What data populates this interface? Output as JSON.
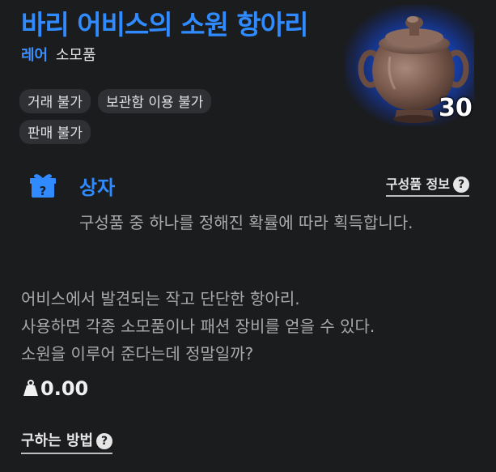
{
  "item": {
    "name": "바리 어비스의 소원 항아리",
    "rarity": "레어",
    "category": "소모품",
    "count": "30",
    "tags": [
      "거래 불가",
      "보관함 이용 불가",
      "판매 불가"
    ],
    "icon": "clay-pot-icon"
  },
  "box": {
    "label": "상자",
    "icon": "gift-box-icon",
    "composition_link": "구성품 정보",
    "description": "구성품 중 하나를 정해진 확률에 따라 획득합니다."
  },
  "description_lines": [
    "어비스에서 발견되는 작고 단단한 항아리.",
    "사용하면 각종 소모품이나 패션 장비를 얻을 수 있다.",
    "소원을 이루어 준다는데 정말일까?"
  ],
  "weight": {
    "icon": "weight-icon",
    "value": "0.00"
  },
  "acquire_link": "구하는 방법",
  "colors": {
    "accent": "#2f8bff",
    "rare": "#3d8fff",
    "background": "#1b1c1e",
    "tag_bg": "#2f3034",
    "glow": "#1f5cff"
  }
}
